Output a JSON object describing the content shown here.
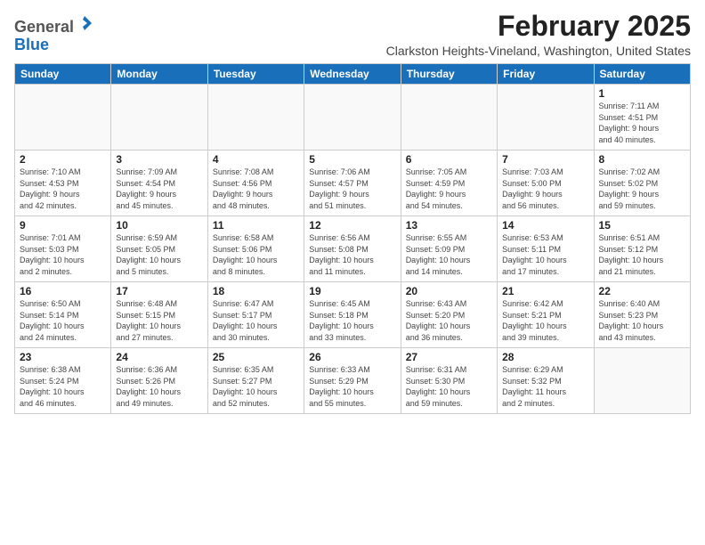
{
  "header": {
    "logo_general": "General",
    "logo_blue": "Blue",
    "month_title": "February 2025",
    "location": "Clarkston Heights-Vineland, Washington, United States"
  },
  "days_of_week": [
    "Sunday",
    "Monday",
    "Tuesday",
    "Wednesday",
    "Thursday",
    "Friday",
    "Saturday"
  ],
  "weeks": [
    [
      {
        "day": "",
        "info": ""
      },
      {
        "day": "",
        "info": ""
      },
      {
        "day": "",
        "info": ""
      },
      {
        "day": "",
        "info": ""
      },
      {
        "day": "",
        "info": ""
      },
      {
        "day": "",
        "info": ""
      },
      {
        "day": "1",
        "info": "Sunrise: 7:11 AM\nSunset: 4:51 PM\nDaylight: 9 hours\nand 40 minutes."
      }
    ],
    [
      {
        "day": "2",
        "info": "Sunrise: 7:10 AM\nSunset: 4:53 PM\nDaylight: 9 hours\nand 42 minutes."
      },
      {
        "day": "3",
        "info": "Sunrise: 7:09 AM\nSunset: 4:54 PM\nDaylight: 9 hours\nand 45 minutes."
      },
      {
        "day": "4",
        "info": "Sunrise: 7:08 AM\nSunset: 4:56 PM\nDaylight: 9 hours\nand 48 minutes."
      },
      {
        "day": "5",
        "info": "Sunrise: 7:06 AM\nSunset: 4:57 PM\nDaylight: 9 hours\nand 51 minutes."
      },
      {
        "day": "6",
        "info": "Sunrise: 7:05 AM\nSunset: 4:59 PM\nDaylight: 9 hours\nand 54 minutes."
      },
      {
        "day": "7",
        "info": "Sunrise: 7:03 AM\nSunset: 5:00 PM\nDaylight: 9 hours\nand 56 minutes."
      },
      {
        "day": "8",
        "info": "Sunrise: 7:02 AM\nSunset: 5:02 PM\nDaylight: 9 hours\nand 59 minutes."
      }
    ],
    [
      {
        "day": "9",
        "info": "Sunrise: 7:01 AM\nSunset: 5:03 PM\nDaylight: 10 hours\nand 2 minutes."
      },
      {
        "day": "10",
        "info": "Sunrise: 6:59 AM\nSunset: 5:05 PM\nDaylight: 10 hours\nand 5 minutes."
      },
      {
        "day": "11",
        "info": "Sunrise: 6:58 AM\nSunset: 5:06 PM\nDaylight: 10 hours\nand 8 minutes."
      },
      {
        "day": "12",
        "info": "Sunrise: 6:56 AM\nSunset: 5:08 PM\nDaylight: 10 hours\nand 11 minutes."
      },
      {
        "day": "13",
        "info": "Sunrise: 6:55 AM\nSunset: 5:09 PM\nDaylight: 10 hours\nand 14 minutes."
      },
      {
        "day": "14",
        "info": "Sunrise: 6:53 AM\nSunset: 5:11 PM\nDaylight: 10 hours\nand 17 minutes."
      },
      {
        "day": "15",
        "info": "Sunrise: 6:51 AM\nSunset: 5:12 PM\nDaylight: 10 hours\nand 21 minutes."
      }
    ],
    [
      {
        "day": "16",
        "info": "Sunrise: 6:50 AM\nSunset: 5:14 PM\nDaylight: 10 hours\nand 24 minutes."
      },
      {
        "day": "17",
        "info": "Sunrise: 6:48 AM\nSunset: 5:15 PM\nDaylight: 10 hours\nand 27 minutes."
      },
      {
        "day": "18",
        "info": "Sunrise: 6:47 AM\nSunset: 5:17 PM\nDaylight: 10 hours\nand 30 minutes."
      },
      {
        "day": "19",
        "info": "Sunrise: 6:45 AM\nSunset: 5:18 PM\nDaylight: 10 hours\nand 33 minutes."
      },
      {
        "day": "20",
        "info": "Sunrise: 6:43 AM\nSunset: 5:20 PM\nDaylight: 10 hours\nand 36 minutes."
      },
      {
        "day": "21",
        "info": "Sunrise: 6:42 AM\nSunset: 5:21 PM\nDaylight: 10 hours\nand 39 minutes."
      },
      {
        "day": "22",
        "info": "Sunrise: 6:40 AM\nSunset: 5:23 PM\nDaylight: 10 hours\nand 43 minutes."
      }
    ],
    [
      {
        "day": "23",
        "info": "Sunrise: 6:38 AM\nSunset: 5:24 PM\nDaylight: 10 hours\nand 46 minutes."
      },
      {
        "day": "24",
        "info": "Sunrise: 6:36 AM\nSunset: 5:26 PM\nDaylight: 10 hours\nand 49 minutes."
      },
      {
        "day": "25",
        "info": "Sunrise: 6:35 AM\nSunset: 5:27 PM\nDaylight: 10 hours\nand 52 minutes."
      },
      {
        "day": "26",
        "info": "Sunrise: 6:33 AM\nSunset: 5:29 PM\nDaylight: 10 hours\nand 55 minutes."
      },
      {
        "day": "27",
        "info": "Sunrise: 6:31 AM\nSunset: 5:30 PM\nDaylight: 10 hours\nand 59 minutes."
      },
      {
        "day": "28",
        "info": "Sunrise: 6:29 AM\nSunset: 5:32 PM\nDaylight: 11 hours\nand 2 minutes."
      },
      {
        "day": "",
        "info": ""
      }
    ]
  ]
}
